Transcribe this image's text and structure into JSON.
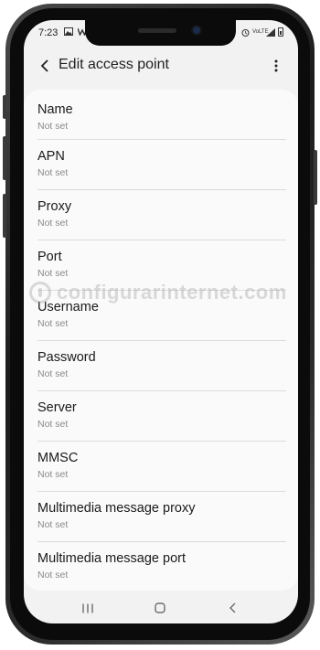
{
  "status_bar": {
    "time": "7:23",
    "left_icons": [
      "image-icon",
      "w-icon"
    ],
    "right_icons": [
      "alarm-icon",
      "volte-icon",
      "signal-icon",
      "battery-icon"
    ],
    "volte_label": "VoLTE"
  },
  "app_bar": {
    "title": "Edit access point",
    "back_icon": "back-arrow-icon",
    "more_icon": "more-vertical-icon"
  },
  "settings": [
    {
      "label": "Name",
      "value": "Not set"
    },
    {
      "label": "APN",
      "value": "Not set"
    },
    {
      "label": "Proxy",
      "value": "Not set"
    },
    {
      "label": "Port",
      "value": "Not set"
    },
    {
      "label": "Username",
      "value": "Not set"
    },
    {
      "label": "Password",
      "value": "Not set"
    },
    {
      "label": "Server",
      "value": "Not set"
    },
    {
      "label": "MMSC",
      "value": "Not set"
    },
    {
      "label": "Multimedia message proxy",
      "value": "Not set"
    },
    {
      "label": "Multimedia message port",
      "value": "Not set"
    }
  ],
  "nav_bar": {
    "recents_icon": "recents-icon",
    "home_icon": "home-icon",
    "back_icon": "nav-back-icon"
  },
  "watermark": {
    "text": "configurarinternet.com"
  },
  "colors": {
    "screen_bg": "#f2f2f2",
    "card_bg": "#fafafa",
    "primary_text": "#1a1a1a",
    "secondary_text": "#8a8a8a",
    "divider": "#dcdcdc"
  }
}
